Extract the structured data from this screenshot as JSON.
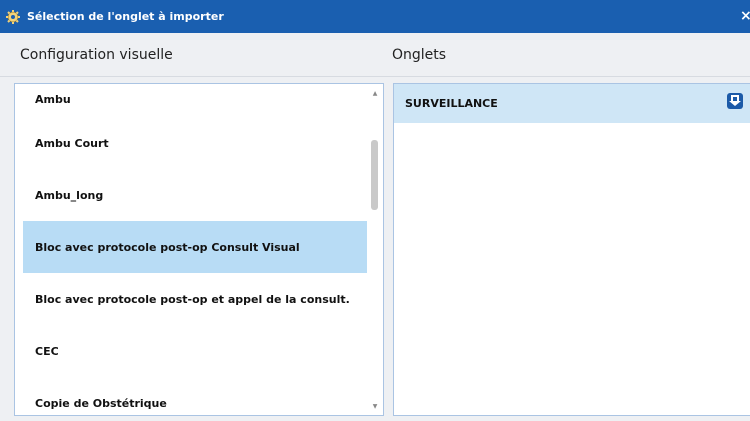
{
  "window": {
    "title": "Sélection de l'onglet à importer",
    "close_glyph": "×",
    "title_icon": "gear-icon"
  },
  "left_pane": {
    "header": "Configuration visuelle",
    "items": [
      {
        "label": "Ambu",
        "selected": false
      },
      {
        "label": "Ambu Court",
        "selected": false
      },
      {
        "label": "Ambu_long",
        "selected": false
      },
      {
        "label": "Bloc avec protocole post-op Consult Visual",
        "selected": true
      },
      {
        "label": "Bloc avec protocole post-op et appel de la consult.",
        "selected": false
      },
      {
        "label": "CEC",
        "selected": false
      },
      {
        "label": "Copie de Obstétrique",
        "selected": false
      }
    ],
    "scroll_up": "▲",
    "scroll_down": "▼"
  },
  "right_pane": {
    "header": "Onglets",
    "items": [
      {
        "label": "SURVEILLANCE",
        "icon": "import-icon"
      }
    ]
  },
  "colors": {
    "titlebar": "#1a5fb0",
    "selected_row": "#b8dcf5",
    "tab_row": "#cfe6f6",
    "panel_border": "#aac4e3"
  }
}
